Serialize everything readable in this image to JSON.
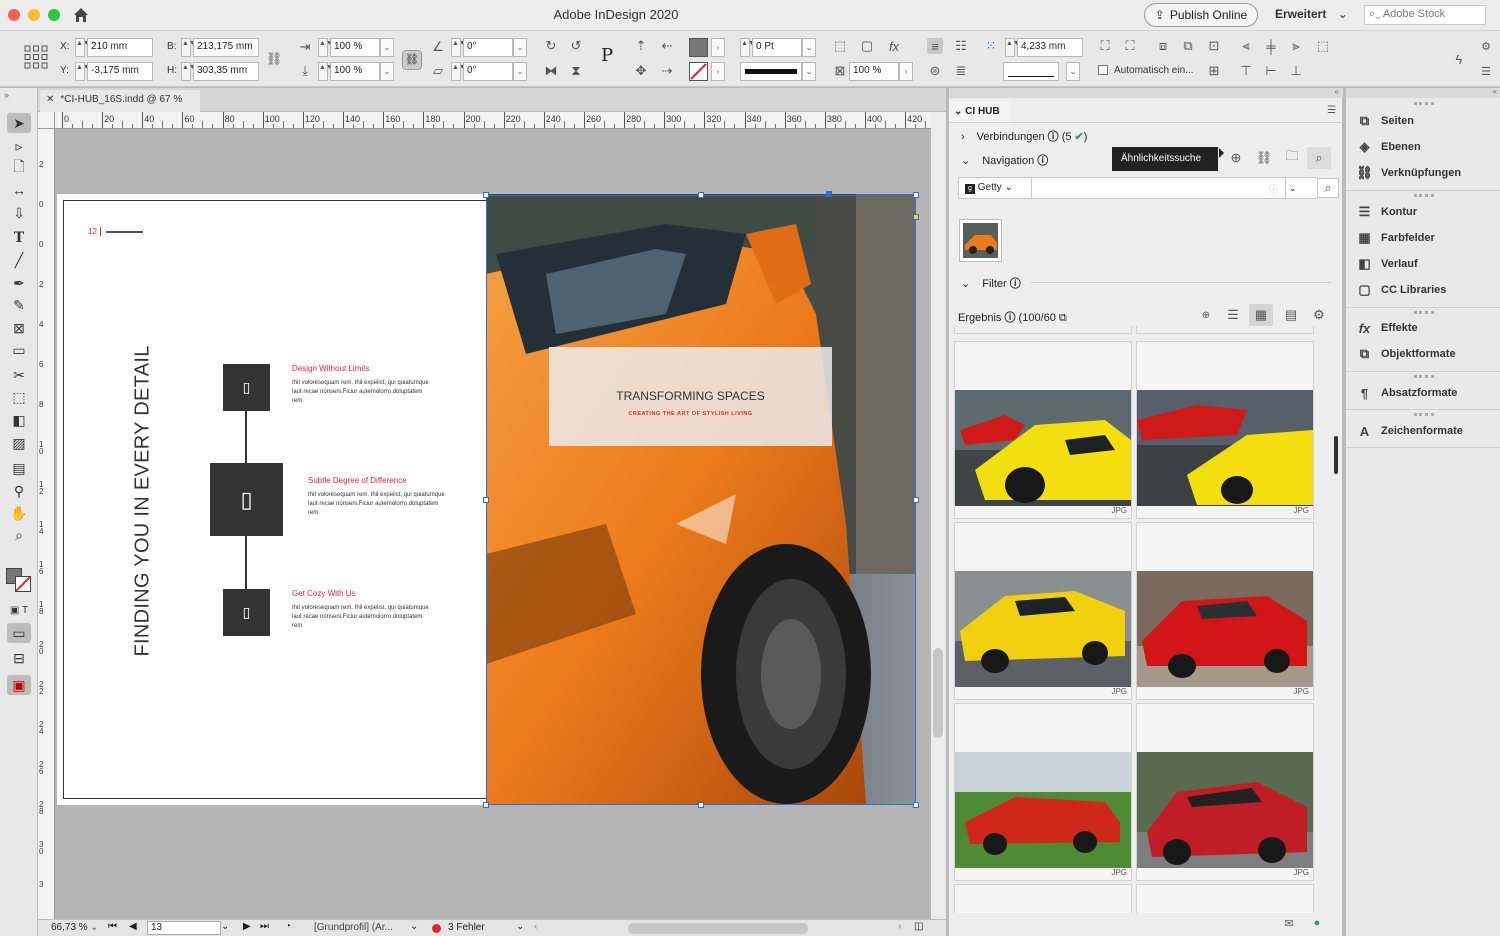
{
  "window": {
    "title": "Adobe InDesign 2020",
    "publish_label": "Publish Online",
    "workspace": "Erweitert",
    "stock_placeholder": "Adobe Stock"
  },
  "control": {
    "x_label": "X:",
    "x": "210 mm",
    "y_label": "Y:",
    "y": "-3,175 mm",
    "w_label": "B:",
    "w": "213,175 mm",
    "h_label": "H:",
    "h": "303,35 mm",
    "scale_x": "100 %",
    "scale_y": "100 %",
    "angle": "0°",
    "shear": "0°",
    "stroke_weight": "0 Pt",
    "opacity": "100 %",
    "offset": "4,233 mm",
    "autofit": "Automatisch ein..."
  },
  "document": {
    "tab": "*CI-HUB_16S.indd @ 67 %"
  },
  "ruler": {
    "marks": [
      "0",
      "20",
      "40",
      "60",
      "80",
      "100",
      "120",
      "140",
      "160",
      "180",
      "200",
      "220",
      "240",
      "260",
      "280",
      "300",
      "320",
      "340",
      "360",
      "380",
      "400",
      "420"
    ],
    "vmarks": [
      "2",
      "0",
      "0",
      "2",
      "4",
      "6",
      "8",
      "1 0",
      "1 2",
      "1 4",
      "1 6",
      "1 8",
      "2 0",
      "2 2",
      "2 4",
      "2 6",
      "2 8",
      "3 0",
      "3"
    ]
  },
  "page": {
    "page_number": "12",
    "vertical_title": "FINDING YOU IN EVERY DETAIL",
    "features": [
      {
        "title": "Design Without Limits",
        "body": "Ihit voloresequam rem. Ihil expelist, qui quiatumque laut recae nonseni.Ficiur autemolorro doluptatem rem"
      },
      {
        "title": "Subtle Degree of Difference",
        "body": "Ihit voloresequam rem. Ihil expelist, qui quiatumque laut recae nonseni.Ficiur autemolorro doluptatem rem"
      },
      {
        "title": "Get Cozy With Us",
        "body": "Ihit voloresequam rem. Ihil expelist, qui quiatumque laut recae nonseni.Ficiur autemolorro doluptatem rem"
      }
    ],
    "overlay_title": "TRANSFORMING SPACES",
    "overlay_subtitle": "CREATING THE ART OF STYLISH LIVING"
  },
  "status": {
    "zoom": "66,73 %",
    "page": "13",
    "profile": "[Grundprofil] (Ar...",
    "errors": "3 Fehler"
  },
  "cihub": {
    "title": "CI HUB",
    "connections_label": "Verbindungen",
    "connections_count": "(5",
    "navigation_label": "Navigation",
    "tooltip": "Ähnlichkeitssuche",
    "source": "Getty",
    "filter_label": "Filter",
    "results_label": "Ergebnis",
    "results_count": "(100/60",
    "file_type": "JPG"
  },
  "dock": {
    "items": [
      "Seiten",
      "Ebenen",
      "Verknüpfungen",
      "Kontur",
      "Farbfelder",
      "Verlauf",
      "CC Libraries",
      "Effekte",
      "Objektformate",
      "Absatzformate",
      "Zeichenformate"
    ]
  },
  "colors": {
    "accent_red": "#e3262e",
    "selection_blue": "#2d6cdf",
    "car_orange": "#ec7a1c"
  }
}
